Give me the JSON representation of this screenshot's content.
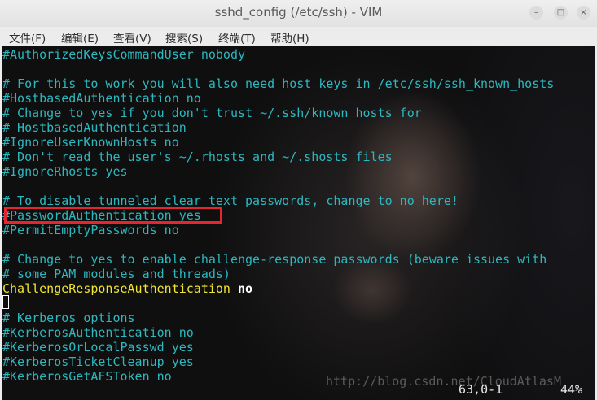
{
  "window": {
    "title": "sshd_config (/etc/ssh) - VIM",
    "controls": {
      "minimize": "–",
      "maximize": "□",
      "close": "×"
    }
  },
  "menu": [
    "文件(F)",
    "编辑(E)",
    "查看(V)",
    "搜索(S)",
    "终端(T)",
    "帮助(H)"
  ],
  "editor": {
    "lines": [
      "#AuthorizedKeysCommandUser nobody",
      "",
      "# For this to work you will also need host keys in /etc/ssh/ssh_known_hosts",
      "#HostbasedAuthentication no",
      "# Change to yes if you don't trust ~/.ssh/known_hosts for",
      "# HostbasedAuthentication",
      "#IgnoreUserKnownHosts no",
      "# Don't read the user's ~/.rhosts and ~/.shosts files",
      "#IgnoreRhosts yes",
      "",
      "# To disable tunneled clear text passwords, change to no here!",
      "#PasswordAuthentication yes",
      "#PermitEmptyPasswords no",
      "",
      "# Change to yes to enable challenge-response passwords (beware issues with",
      "# some PAM modules and threads)",
      "ChallengeResponseAuthentication",
      "",
      "# Kerberos options",
      "#KerberosAuthentication no",
      "#KerberosOrLocalPasswd yes",
      "#KerberosTicketCleanup yes",
      "#KerberosGetAFSToken no"
    ],
    "challenge_value": "no",
    "highlighted_line": "#PasswordAuthentication yes",
    "colors": {
      "comment": "#2bb8bf",
      "keyword": "#f0e62e",
      "highlight_border": "#e3262f"
    }
  },
  "status": {
    "position": "63,0-1",
    "percent": "44%"
  },
  "watermark": "http://blog.csdn.net/CloudAtlasM"
}
